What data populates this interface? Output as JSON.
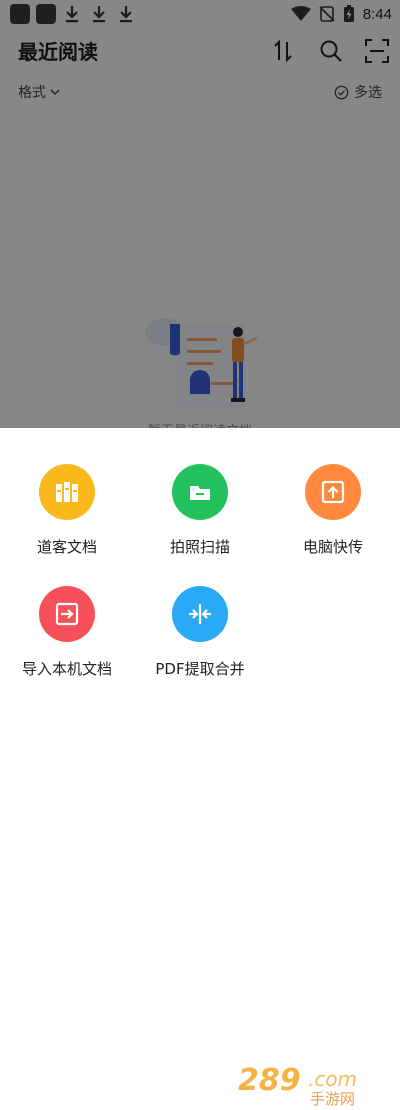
{
  "status_bar": {
    "time": "8:44"
  },
  "header": {
    "title": "最近阅读"
  },
  "filter": {
    "format_label": "格式",
    "multi_select_label": "多选"
  },
  "empty_state": {
    "text": "暂无最近阅读文档"
  },
  "sheet": {
    "actions": [
      {
        "label": "道客文档",
        "color": "#f9b81b",
        "icon": "book-shelf-icon"
      },
      {
        "label": "拍照扫描",
        "color": "#22c15e",
        "icon": "scan-icon"
      },
      {
        "label": "电脑快传",
        "color": "#ff8a3d",
        "icon": "upload-icon"
      },
      {
        "label": "导入本机文档",
        "color": "#f7505a",
        "icon": "import-icon"
      },
      {
        "label": "PDF提取合并",
        "color": "#2aa9f5",
        "icon": "merge-icon"
      }
    ]
  },
  "watermark": {
    "text": "289.com",
    "subtext": "手游网"
  }
}
